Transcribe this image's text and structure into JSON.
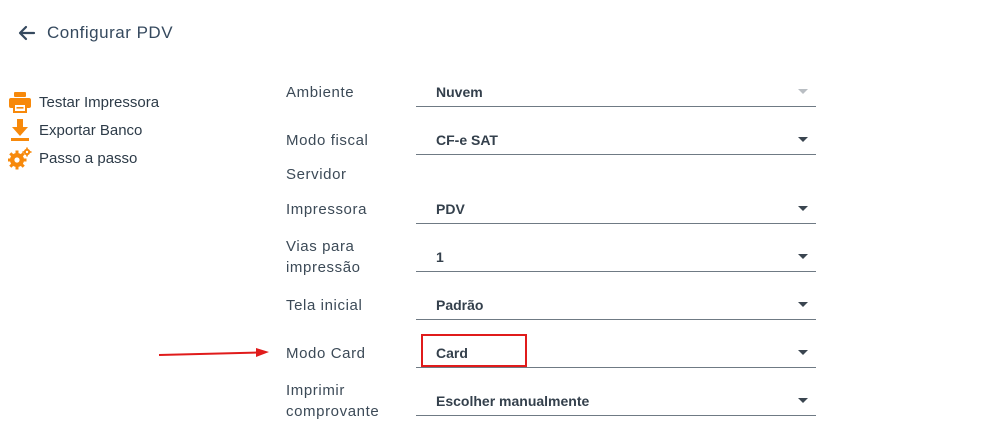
{
  "header": {
    "title": "Configurar PDV",
    "back_icon": "arrow-left-icon"
  },
  "sidebar": {
    "accent_color": "#f7890b",
    "items": [
      {
        "label": "Testar Impressora",
        "icon": "printer-icon"
      },
      {
        "label": "Exportar Banco",
        "icon": "download-icon"
      },
      {
        "label": "Passo a passo",
        "icon": "gears-icon"
      }
    ]
  },
  "form": {
    "ambiente": {
      "label": "Ambiente",
      "value": "Nuvem",
      "disabled": true
    },
    "modo_fiscal": {
      "label": "Modo fiscal",
      "value": "CF-e SAT"
    },
    "servidor": {
      "label": "Servidor"
    },
    "impressora": {
      "label": "Impressora",
      "value": "PDV"
    },
    "vias": {
      "label_line1": "Vias para",
      "label_line2": "impressão",
      "value": "1"
    },
    "tela_inicial": {
      "label": "Tela inicial",
      "value": "Padrão"
    },
    "modo_card": {
      "label": "Modo Card",
      "value": "Card"
    },
    "imprimir": {
      "label_line1": "Imprimir",
      "label_line2": "comprovante",
      "value": "Escolher manualmente"
    }
  },
  "annotation": {
    "color": "#e01b1b"
  }
}
